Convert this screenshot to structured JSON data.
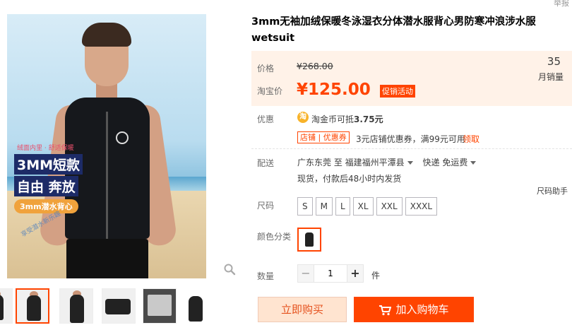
{
  "product": {
    "title": "3mm无袖加绒保暖冬泳湿衣分体潜水服背心男防寒冲浪涉水服wetsuit",
    "corner_note": "举报"
  },
  "gallery": {
    "promo_line1": "绒面内里 · 舒适保暖",
    "promo_line2": "3MM短款",
    "promo_line3": "自由 奔放",
    "promo_pill": "3mm潜水背心",
    "stamp": "享受潜水新乐趣"
  },
  "price": {
    "label": "价格",
    "original": "¥268.00",
    "taobao_label": "淘宝价",
    "current": "¥125.00",
    "promo_tag": "促销活动",
    "monthly_sales": "35",
    "monthly_sales_label": "月销量"
  },
  "discount": {
    "label": "优惠",
    "coin_icon_char": "淘",
    "coin_text_prefix": "淘金币可抵",
    "coin_amount": "3.75元",
    "shop_coupon_tag": "店铺 | 优惠券",
    "coupon_text": "3元店铺优惠券，满99元可用",
    "coupon_link": "领取"
  },
  "shipping": {
    "label": "配送",
    "from": "广东东莞 至",
    "to": "福建福州平潭县",
    "method": "快递 免运费",
    "note": "现货，付款后48小时内发货",
    "size_helper": "尺码助手"
  },
  "sizes": {
    "label": "尺码",
    "options": [
      "S",
      "M",
      "L",
      "XL",
      "XXL",
      "XXXL"
    ]
  },
  "color": {
    "label": "颜色分类"
  },
  "quantity": {
    "label": "数量",
    "minus": "−",
    "value": "1",
    "plus": "+",
    "unit": "件"
  },
  "actions": {
    "buy_now": "立即购买",
    "add_cart": "加入购物车"
  },
  "colors": {
    "accent": "#ff4400",
    "price_bg": "#fff2e8",
    "buy_now_bg": "#ffe4d0"
  }
}
